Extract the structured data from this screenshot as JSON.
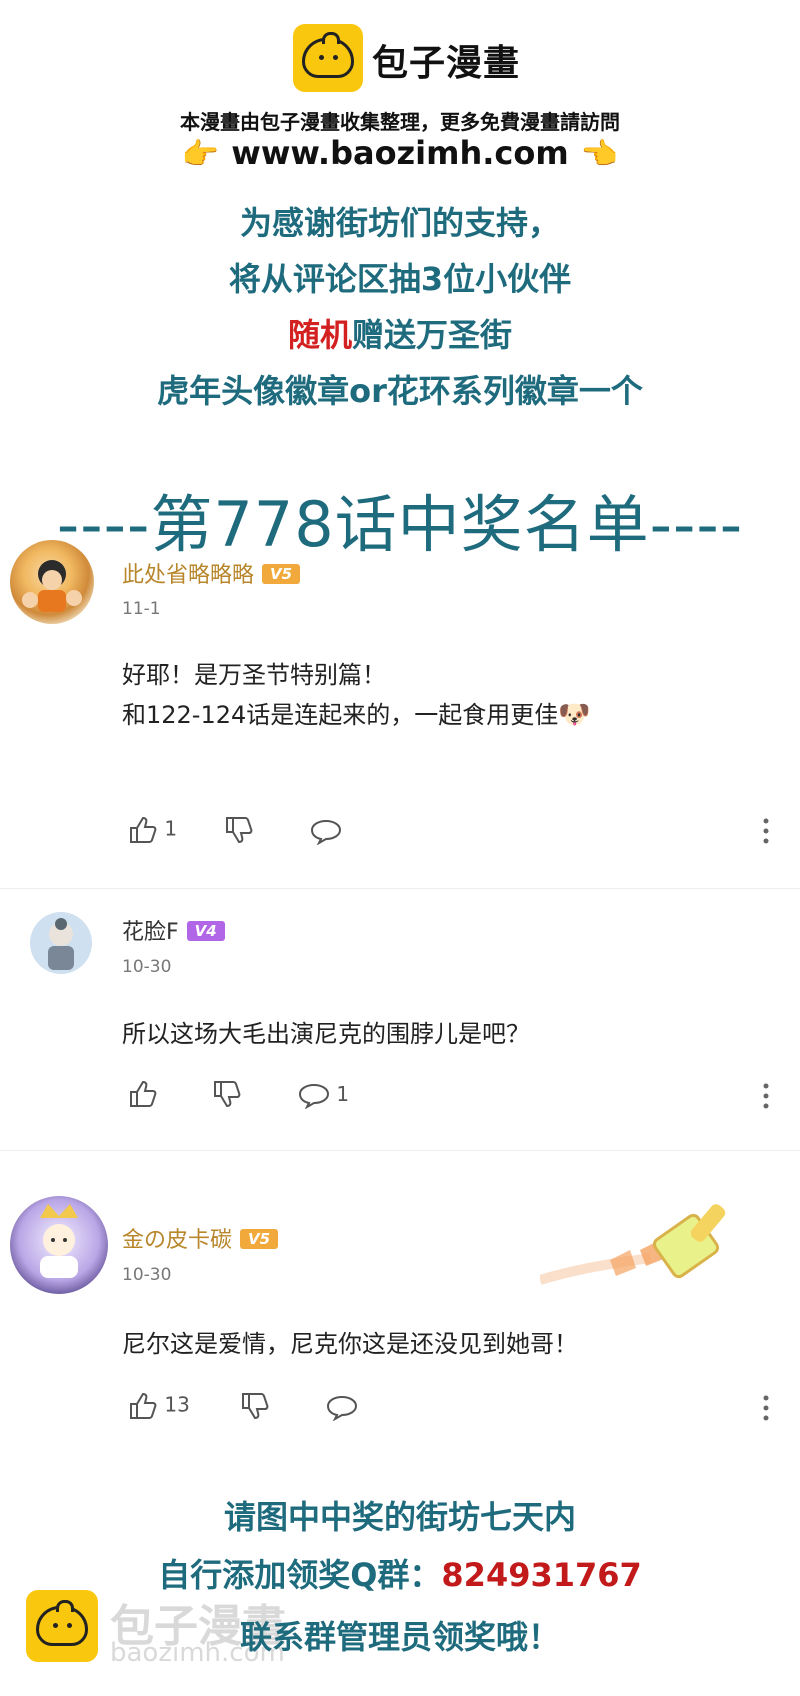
{
  "header": {
    "brand": "包子漫畫",
    "notice": "本漫畫由包子漫畫收集整理，更多免費漫畫請訪問",
    "url": "www.baozimh.com"
  },
  "promo": {
    "line1": "为感谢街坊们的支持，",
    "line2": "将从评论区抽3位小伙伴",
    "line3_red": "随机",
    "line3_rest": "赠送万圣街",
    "line4": "虎年头像徽章or花环系列徽章一个"
  },
  "winners_title": "----第778话中奖名单----",
  "comments": [
    {
      "username": "此处省略略略",
      "level": "V5",
      "date": "11-1",
      "text_lines": [
        "好耶！是万圣节特别篇！",
        "和122-124话是连起来的，一起食用更佳"
      ],
      "likes": "1",
      "replies": ""
    },
    {
      "username": "花脸F",
      "level": "V4",
      "date": "10-30",
      "text_lines": [
        "所以这场大毛出演尼克的围脖儿是吧？"
      ],
      "likes": "",
      "replies": "1"
    },
    {
      "username": "金の皮卡碳",
      "level": "V5",
      "date": "10-30",
      "text_lines": [
        "尼尔这是爱情，尼克你这是还没见到她哥！"
      ],
      "likes": "13",
      "replies": ""
    }
  ],
  "footer": {
    "line1": "请图中中奖的街坊七天内",
    "line2_prefix": "自行添加领奖Q群：",
    "line2_number": "824931767",
    "line3": "联系群管理员领奖哦！"
  },
  "watermark": {
    "brand": "包子漫畫",
    "url": "baozimh.com"
  },
  "colors": {
    "teal": "#1f6b7e",
    "red": "#d32020",
    "gold_name": "#b8862b",
    "v5_badge": "#f0a93a",
    "v4_badge": "#b066e6",
    "logo_yellow": "#f9c80e"
  }
}
